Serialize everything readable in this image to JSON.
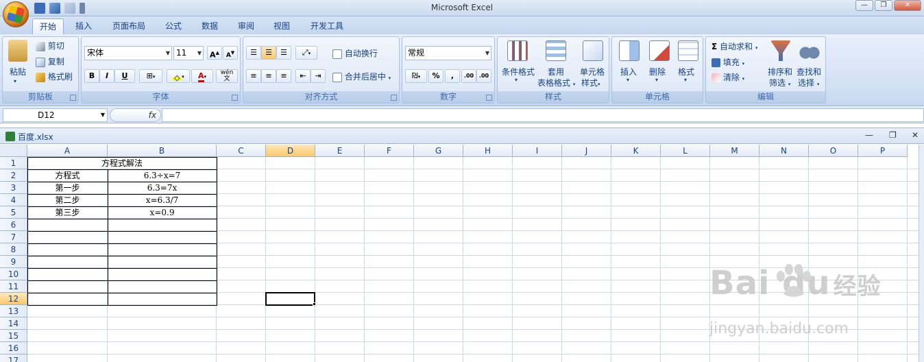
{
  "app": {
    "title": "Microsoft Excel"
  },
  "tabs": [
    "开始",
    "插入",
    "页面布局",
    "公式",
    "数据",
    "审阅",
    "视图",
    "开发工具"
  ],
  "ribbon": {
    "clipboard": {
      "label": "剪贴板",
      "paste": "粘贴",
      "cut": "剪切",
      "copy": "复制",
      "format_painter": "格式刷"
    },
    "font": {
      "label": "字体",
      "font_name": "宋体",
      "font_size": "11",
      "bold": "B",
      "italic": "I",
      "underline": "U",
      "grow": "A",
      "shrink": "A",
      "font_color": "A",
      "phonetic": "wén 文"
    },
    "alignment": {
      "label": "对齐方式",
      "wrap_text": "自动换行",
      "merge_center": "合并后居中"
    },
    "number": {
      "label": "数字",
      "format": "常规",
      "percent": "%",
      "comma": ",",
      "inc_decimal": ".00",
      "dec_decimal": ".00"
    },
    "styles": {
      "label": "样式",
      "conditional": "条件格式",
      "table_line1": "套用",
      "table_line2": "表格格式",
      "cell_line1": "单元格",
      "cell_line2": "样式"
    },
    "cells": {
      "label": "单元格",
      "insert": "插入",
      "delete": "删除",
      "format": "格式"
    },
    "editing": {
      "label": "编辑",
      "autosum": "自动求和",
      "fill": "填充",
      "clear": "清除",
      "sort_line1": "排序和",
      "sort_line2": "筛选",
      "find_line1": "查找和",
      "find_line2": "选择"
    }
  },
  "formula_bar": {
    "name_box": "D12",
    "fx": "fx",
    "value": ""
  },
  "workbook": {
    "name": "百度.xlsx"
  },
  "sheet": {
    "columns": [
      "A",
      "B",
      "C",
      "D",
      "E",
      "F",
      "G",
      "H",
      "I",
      "J",
      "K",
      "L",
      "M",
      "N",
      "O",
      "P"
    ],
    "rows": [
      "1",
      "2",
      "3",
      "4",
      "5",
      "6",
      "7",
      "8",
      "9",
      "10",
      "11",
      "12",
      "13",
      "14",
      "15",
      "16",
      "17"
    ],
    "selected_column": "D",
    "selected_row": "12",
    "title_cell": "方程式解法",
    "data": [
      {
        "a": "方程式",
        "b": "6.3÷x=7"
      },
      {
        "a": "第一步",
        "b": "6.3=7x"
      },
      {
        "a": "第二步",
        "b": "x=6.3/7"
      },
      {
        "a": "第三步",
        "b": "x=0.9"
      }
    ]
  },
  "watermark": {
    "brand": "Bai du",
    "cn": "经验",
    "url": "jingyan.baidu.com"
  }
}
